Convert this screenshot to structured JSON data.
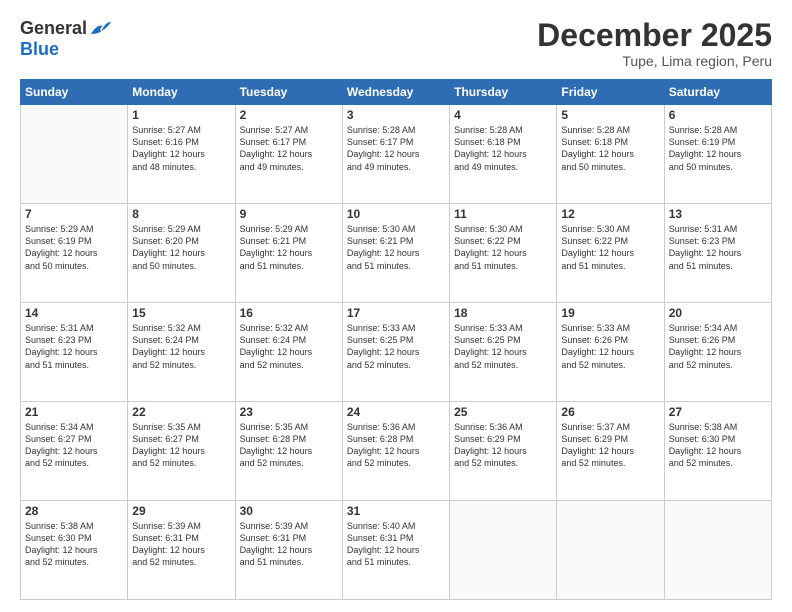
{
  "logo": {
    "general": "General",
    "blue": "Blue"
  },
  "title": "December 2025",
  "location": "Tupe, Lima region, Peru",
  "headers": [
    "Sunday",
    "Monday",
    "Tuesday",
    "Wednesday",
    "Thursday",
    "Friday",
    "Saturday"
  ],
  "weeks": [
    [
      {
        "day": "",
        "info": ""
      },
      {
        "day": "1",
        "info": "Sunrise: 5:27 AM\nSunset: 6:16 PM\nDaylight: 12 hours\nand 48 minutes."
      },
      {
        "day": "2",
        "info": "Sunrise: 5:27 AM\nSunset: 6:17 PM\nDaylight: 12 hours\nand 49 minutes."
      },
      {
        "day": "3",
        "info": "Sunrise: 5:28 AM\nSunset: 6:17 PM\nDaylight: 12 hours\nand 49 minutes."
      },
      {
        "day": "4",
        "info": "Sunrise: 5:28 AM\nSunset: 6:18 PM\nDaylight: 12 hours\nand 49 minutes."
      },
      {
        "day": "5",
        "info": "Sunrise: 5:28 AM\nSunset: 6:18 PM\nDaylight: 12 hours\nand 50 minutes."
      },
      {
        "day": "6",
        "info": "Sunrise: 5:28 AM\nSunset: 6:19 PM\nDaylight: 12 hours\nand 50 minutes."
      }
    ],
    [
      {
        "day": "7",
        "info": "Sunrise: 5:29 AM\nSunset: 6:19 PM\nDaylight: 12 hours\nand 50 minutes."
      },
      {
        "day": "8",
        "info": "Sunrise: 5:29 AM\nSunset: 6:20 PM\nDaylight: 12 hours\nand 50 minutes."
      },
      {
        "day": "9",
        "info": "Sunrise: 5:29 AM\nSunset: 6:21 PM\nDaylight: 12 hours\nand 51 minutes."
      },
      {
        "day": "10",
        "info": "Sunrise: 5:30 AM\nSunset: 6:21 PM\nDaylight: 12 hours\nand 51 minutes."
      },
      {
        "day": "11",
        "info": "Sunrise: 5:30 AM\nSunset: 6:22 PM\nDaylight: 12 hours\nand 51 minutes."
      },
      {
        "day": "12",
        "info": "Sunrise: 5:30 AM\nSunset: 6:22 PM\nDaylight: 12 hours\nand 51 minutes."
      },
      {
        "day": "13",
        "info": "Sunrise: 5:31 AM\nSunset: 6:23 PM\nDaylight: 12 hours\nand 51 minutes."
      }
    ],
    [
      {
        "day": "14",
        "info": "Sunrise: 5:31 AM\nSunset: 6:23 PM\nDaylight: 12 hours\nand 51 minutes."
      },
      {
        "day": "15",
        "info": "Sunrise: 5:32 AM\nSunset: 6:24 PM\nDaylight: 12 hours\nand 52 minutes."
      },
      {
        "day": "16",
        "info": "Sunrise: 5:32 AM\nSunset: 6:24 PM\nDaylight: 12 hours\nand 52 minutes."
      },
      {
        "day": "17",
        "info": "Sunrise: 5:33 AM\nSunset: 6:25 PM\nDaylight: 12 hours\nand 52 minutes."
      },
      {
        "day": "18",
        "info": "Sunrise: 5:33 AM\nSunset: 6:25 PM\nDaylight: 12 hours\nand 52 minutes."
      },
      {
        "day": "19",
        "info": "Sunrise: 5:33 AM\nSunset: 6:26 PM\nDaylight: 12 hours\nand 52 minutes."
      },
      {
        "day": "20",
        "info": "Sunrise: 5:34 AM\nSunset: 6:26 PM\nDaylight: 12 hours\nand 52 minutes."
      }
    ],
    [
      {
        "day": "21",
        "info": "Sunrise: 5:34 AM\nSunset: 6:27 PM\nDaylight: 12 hours\nand 52 minutes."
      },
      {
        "day": "22",
        "info": "Sunrise: 5:35 AM\nSunset: 6:27 PM\nDaylight: 12 hours\nand 52 minutes."
      },
      {
        "day": "23",
        "info": "Sunrise: 5:35 AM\nSunset: 6:28 PM\nDaylight: 12 hours\nand 52 minutes."
      },
      {
        "day": "24",
        "info": "Sunrise: 5:36 AM\nSunset: 6:28 PM\nDaylight: 12 hours\nand 52 minutes."
      },
      {
        "day": "25",
        "info": "Sunrise: 5:36 AM\nSunset: 6:29 PM\nDaylight: 12 hours\nand 52 minutes."
      },
      {
        "day": "26",
        "info": "Sunrise: 5:37 AM\nSunset: 6:29 PM\nDaylight: 12 hours\nand 52 minutes."
      },
      {
        "day": "27",
        "info": "Sunrise: 5:38 AM\nSunset: 6:30 PM\nDaylight: 12 hours\nand 52 minutes."
      }
    ],
    [
      {
        "day": "28",
        "info": "Sunrise: 5:38 AM\nSunset: 6:30 PM\nDaylight: 12 hours\nand 52 minutes."
      },
      {
        "day": "29",
        "info": "Sunrise: 5:39 AM\nSunset: 6:31 PM\nDaylight: 12 hours\nand 52 minutes."
      },
      {
        "day": "30",
        "info": "Sunrise: 5:39 AM\nSunset: 6:31 PM\nDaylight: 12 hours\nand 51 minutes."
      },
      {
        "day": "31",
        "info": "Sunrise: 5:40 AM\nSunset: 6:31 PM\nDaylight: 12 hours\nand 51 minutes."
      },
      {
        "day": "",
        "info": ""
      },
      {
        "day": "",
        "info": ""
      },
      {
        "day": "",
        "info": ""
      }
    ]
  ]
}
